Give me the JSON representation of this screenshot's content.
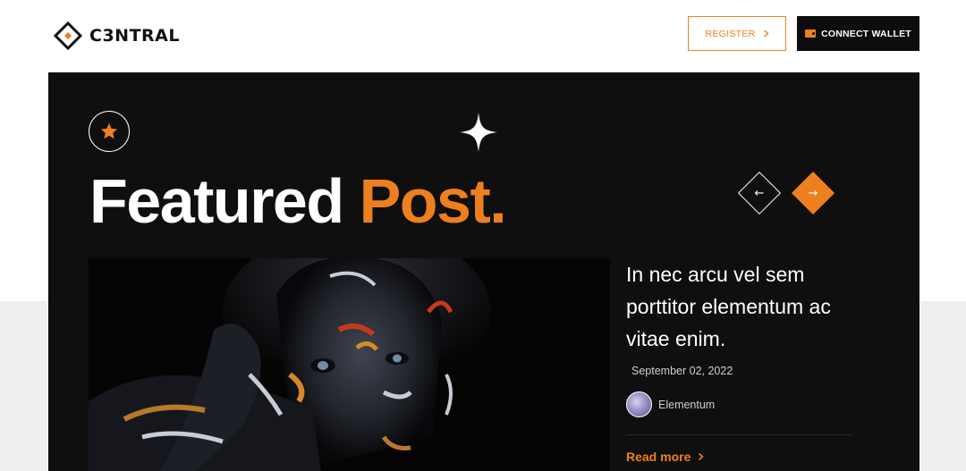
{
  "header": {
    "logo_text": "C3NTRAL",
    "register_label": "REGISTER",
    "connect_label": "CONNECT WALLET"
  },
  "hero": {
    "heading_white": "Featured",
    "heading_orange": "Post."
  },
  "post": {
    "title": "In nec arcu vel sem porttitor elementum ac vitae enim.",
    "date": "September 02, 2022",
    "author": "Elementum",
    "read_more": "Read more"
  },
  "icons": {
    "prev": "arrow-left-icon",
    "next": "arrow-right-icon",
    "badge": "star-icon",
    "wallet": "wallet-icon"
  },
  "colors": {
    "accent": "#ee7f1f",
    "panel": "#0f0f0f",
    "background": "#ffffff",
    "lower_background": "#efefef"
  }
}
